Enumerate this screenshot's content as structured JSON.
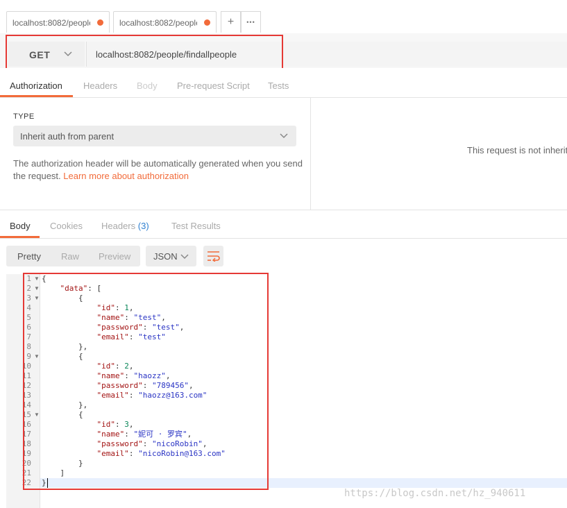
{
  "tabs": [
    {
      "label": "localhost:8082/people"
    },
    {
      "label": "localhost:8082/people"
    }
  ],
  "tab_buttons": {
    "add": "+",
    "more": "•••"
  },
  "request": {
    "method": "GET",
    "url": "localhost:8082/people/findallpeople"
  },
  "request_tabs": [
    "Authorization",
    "Headers",
    "Body",
    "Pre-request Script",
    "Tests"
  ],
  "auth": {
    "type_label": "TYPE",
    "type_value": "Inherit auth from parent",
    "help_text": "The authorization header will be automatically generated when you send the request.",
    "help_link": "Learn more about authorization",
    "right_message": "This request is not inheriti"
  },
  "response_tabs": {
    "body": "Body",
    "cookies": "Cookies",
    "headers": "Headers",
    "headers_count": "(3)",
    "test_results": "Test Results"
  },
  "view_modes": [
    "Pretty",
    "Raw",
    "Preview"
  ],
  "format": "JSON",
  "code_lines": [
    "{",
    "    \"data\": [",
    "        {",
    "            \"id\": 1,",
    "            \"name\": \"test\",",
    "            \"password\": \"test\",",
    "            \"email\": \"test\"",
    "        },",
    "        {",
    "            \"id\": 2,",
    "            \"name\": \"haozz\",",
    "            \"password\": \"789456\",",
    "            \"email\": \"haozz@163.com\"",
    "        },",
    "        {",
    "            \"id\": 3,",
    "            \"name\": \"妮可 · 罗宾\",",
    "            \"password\": \"nicoRobin\",",
    "            \"email\": \"nicoRobin@163.com\"",
    "        }",
    "    ]",
    "}"
  ],
  "watermark": "https://blog.csdn.net/hz_940611",
  "colors": {
    "accent": "#f26b3a",
    "highlight_box": "#e53935",
    "link_count": "#2f80d1"
  }
}
